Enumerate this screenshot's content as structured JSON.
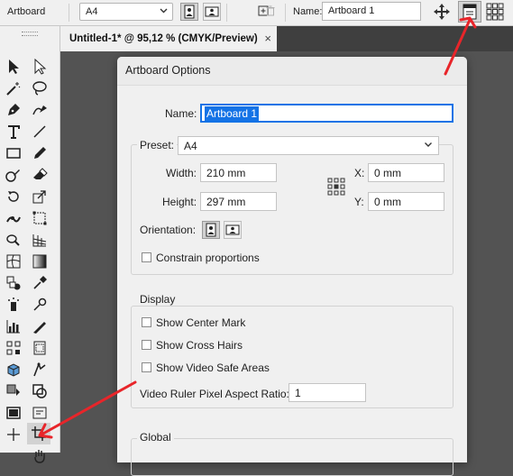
{
  "control_bar": {
    "mode_label": "Artboard",
    "preset_value": "A4",
    "name_label": "Name:",
    "name_value": "Artboard 1"
  },
  "document": {
    "tab_title": "Untitled-1* @ 95,12 % (CMYK/Preview)",
    "close_glyph": "×"
  },
  "dialog": {
    "title": "Artboard Options",
    "name_label": "Name:",
    "name_value": "Artboard 1",
    "preset_label": "Preset:",
    "preset_value": "A4",
    "width_label": "Width:",
    "width_value": "210 mm",
    "height_label": "Height:",
    "height_value": "297 mm",
    "x_label": "X:",
    "x_value": "0 mm",
    "y_label": "Y:",
    "y_value": "0 mm",
    "orientation_label": "Orientation:",
    "constrain_label": "Constrain proportions",
    "display_title": "Display",
    "show_center_mark": "Show Center Mark",
    "show_cross_hairs": "Show Cross Hairs",
    "show_video_safe": "Show Video Safe Areas",
    "video_ruler_label": "Video Ruler Pixel Aspect Ratio:",
    "video_ruler_value": "1",
    "global_title": "Global"
  },
  "colors": {
    "annotation_arrow": "#e8252a",
    "selection": "#1473e6"
  }
}
